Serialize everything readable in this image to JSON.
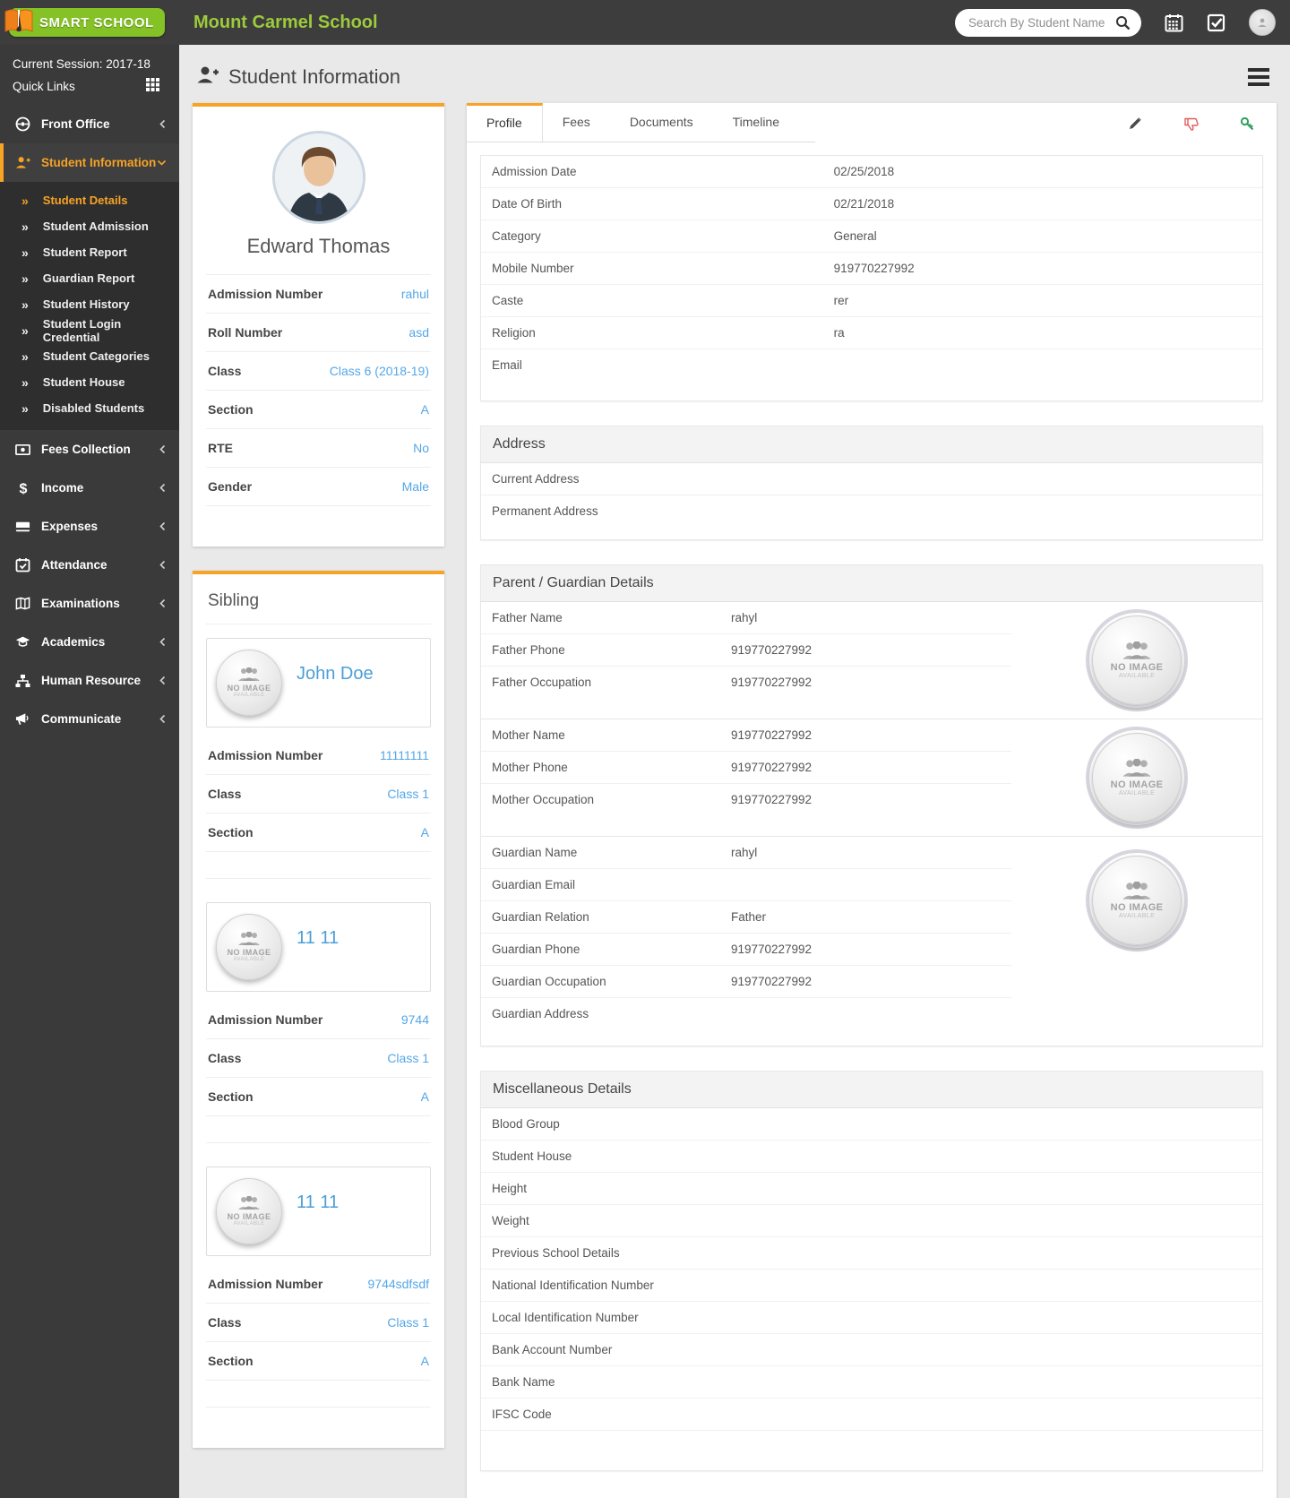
{
  "header": {
    "logo_text": "SMART SCHOOL",
    "school_name": "Mount Carmel School",
    "search_placeholder": "Search By Student Name",
    "icons": [
      "calendar-icon",
      "task-check-icon",
      "user-avatar"
    ]
  },
  "sidebar": {
    "session": "Current Session: 2017-18",
    "quick_links": "Quick Links",
    "items": [
      {
        "label": "Front Office",
        "icon": "front-office-icon"
      },
      {
        "label": "Student Information",
        "icon": "student-information-icon",
        "active": true
      },
      {
        "label": "Fees Collection",
        "icon": "fees-collection-icon"
      },
      {
        "label": "Income",
        "icon": "income-icon"
      },
      {
        "label": "Expenses",
        "icon": "expenses-icon"
      },
      {
        "label": "Attendance",
        "icon": "attendance-icon"
      },
      {
        "label": "Examinations",
        "icon": "examinations-icon"
      },
      {
        "label": "Academics",
        "icon": "academics-icon"
      },
      {
        "label": "Human Resource",
        "icon": "human-resource-icon"
      },
      {
        "label": "Communicate",
        "icon": "communicate-icon"
      }
    ],
    "submenu": [
      {
        "label": "Student Details",
        "active": true
      },
      {
        "label": "Student Admission"
      },
      {
        "label": "Student Report"
      },
      {
        "label": "Guardian Report"
      },
      {
        "label": "Student History"
      },
      {
        "label": "Student Login Credential"
      },
      {
        "label": "Student Categories"
      },
      {
        "label": "Student House"
      },
      {
        "label": "Disabled Students"
      }
    ],
    "submenu_arrow": "»"
  },
  "page": {
    "title": "Student Information"
  },
  "student": {
    "name": "Edward Thomas",
    "rows": [
      {
        "label": "Admission Number",
        "value": "rahul"
      },
      {
        "label": "Roll Number",
        "value": "asd"
      },
      {
        "label": "Class",
        "value": "Class 6 (2018-19)"
      },
      {
        "label": "Section",
        "value": "A"
      },
      {
        "label": "RTE",
        "value": "No"
      },
      {
        "label": "Gender",
        "value": "Male"
      }
    ]
  },
  "sibling": {
    "title": "Sibling",
    "no_image": {
      "line1": "NO IMAGE",
      "line2": "AVAILABLE"
    },
    "list": [
      {
        "name": "John Doe",
        "rows": [
          {
            "label": "Admission Number",
            "value": "11111111"
          },
          {
            "label": "Class",
            "value": "Class 1"
          },
          {
            "label": "Section",
            "value": "A"
          }
        ]
      },
      {
        "name": "11 11",
        "rows": [
          {
            "label": "Admission Number",
            "value": "9744"
          },
          {
            "label": "Class",
            "value": "Class 1"
          },
          {
            "label": "Section",
            "value": "A"
          }
        ]
      },
      {
        "name": "11 11",
        "rows": [
          {
            "label": "Admission Number",
            "value": "9744sdfsdf"
          },
          {
            "label": "Class",
            "value": "Class 1"
          },
          {
            "label": "Section",
            "value": "A"
          }
        ]
      }
    ]
  },
  "tabs": {
    "items": [
      {
        "label": "Profile",
        "active": true
      },
      {
        "label": "Fees"
      },
      {
        "label": "Documents"
      },
      {
        "label": "Timeline"
      }
    ],
    "actions": [
      "edit-pencil-icon",
      "thumbs-down-icon",
      "key-icon"
    ]
  },
  "profile": {
    "rows": [
      {
        "label": "Admission Date",
        "value": "02/25/2018"
      },
      {
        "label": "Date Of Birth",
        "value": "02/21/2018"
      },
      {
        "label": "Category",
        "value": "General"
      },
      {
        "label": "Mobile Number",
        "value": "919770227992"
      },
      {
        "label": "Caste",
        "value": "rer"
      },
      {
        "label": "Religion",
        "value": "ra"
      },
      {
        "label": "Email",
        "value": ""
      }
    ]
  },
  "address": {
    "title": "Address",
    "rows": [
      {
        "label": "Current Address",
        "value": ""
      },
      {
        "label": "Permanent Address",
        "value": ""
      }
    ]
  },
  "parent": {
    "title": "Parent / Guardian Details",
    "father_rows": [
      {
        "label": "Father Name",
        "value": "rahyl"
      },
      {
        "label": "Father Phone",
        "value": "919770227992"
      },
      {
        "label": "Father Occupation",
        "value": "919770227992"
      }
    ],
    "mother_rows": [
      {
        "label": "Mother Name",
        "value": "919770227992"
      },
      {
        "label": "Mother Phone",
        "value": "919770227992"
      },
      {
        "label": "Mother Occupation",
        "value": "919770227992"
      }
    ],
    "guardian_rows": [
      {
        "label": "Guardian Name",
        "value": "rahyl"
      },
      {
        "label": "Guardian Email",
        "value": ""
      },
      {
        "label": "Guardian Relation",
        "value": "Father"
      },
      {
        "label": "Guardian Phone",
        "value": "919770227992"
      },
      {
        "label": "Guardian Occupation",
        "value": "919770227992"
      },
      {
        "label": "Guardian Address",
        "value": ""
      }
    ]
  },
  "misc": {
    "title": "Miscellaneous Details",
    "rows": [
      {
        "label": "Blood Group",
        "value": ""
      },
      {
        "label": "Student House",
        "value": ""
      },
      {
        "label": "Height",
        "value": ""
      },
      {
        "label": "Weight",
        "value": ""
      },
      {
        "label": "Previous School Details",
        "value": ""
      },
      {
        "label": "National Identification Number",
        "value": ""
      },
      {
        "label": "Local Identification Number",
        "value": ""
      },
      {
        "label": "Bank Account Number",
        "value": ""
      },
      {
        "label": "Bank Name",
        "value": ""
      },
      {
        "label": "IFSC Code",
        "value": ""
      }
    ]
  },
  "colors": {
    "accent_orange": "#f7a325",
    "brand_green": "#85c226",
    "link_blue": "#54a7e8",
    "dark_bar": "#3d3d3d"
  }
}
